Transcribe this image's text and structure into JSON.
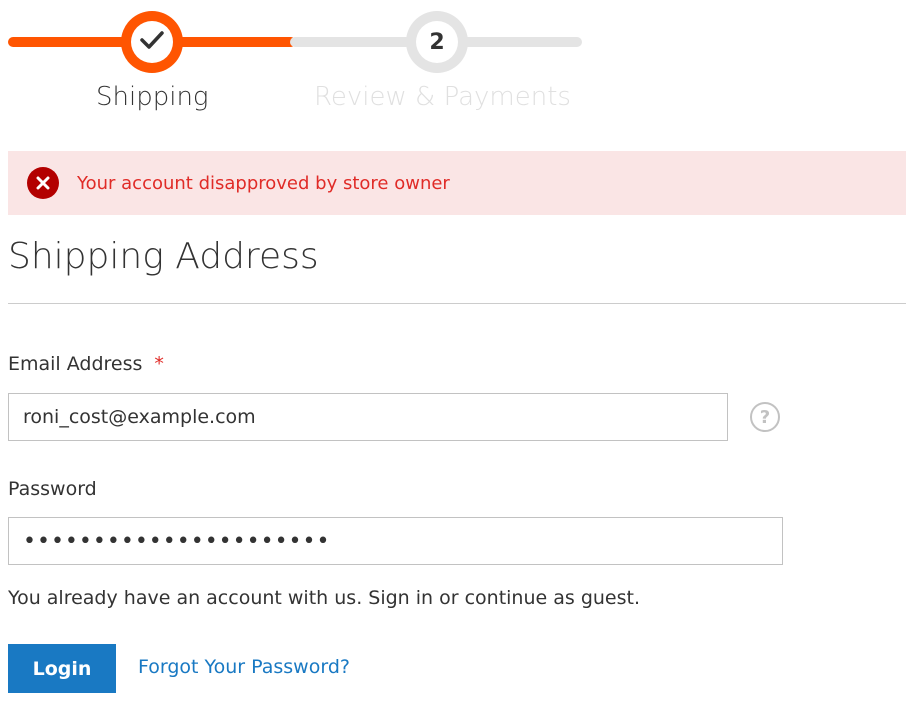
{
  "progress": {
    "steps": [
      {
        "label": "Shipping",
        "marker": "check-icon",
        "state": "active"
      },
      {
        "label": "Review & Payments",
        "marker": "2",
        "state": "inactive"
      }
    ],
    "colors": {
      "active": "#ff5501",
      "inactive": "#e4e4e4"
    }
  },
  "error": {
    "icon": "error-x-icon",
    "text": "Your account disapproved by store owner"
  },
  "shipping": {
    "title": "Shipping Address"
  },
  "email": {
    "label": "Email Address",
    "required_marker": "*",
    "value": "roni_cost@example.com",
    "help_icon": "question-mark-icon"
  },
  "password": {
    "label": "Password",
    "value": "••••••••••••••••••••••"
  },
  "note": "You already have an account with us. Sign in or continue as guest.",
  "actions": {
    "login_label": "Login",
    "forgot_label": "Forgot Your Password?"
  }
}
